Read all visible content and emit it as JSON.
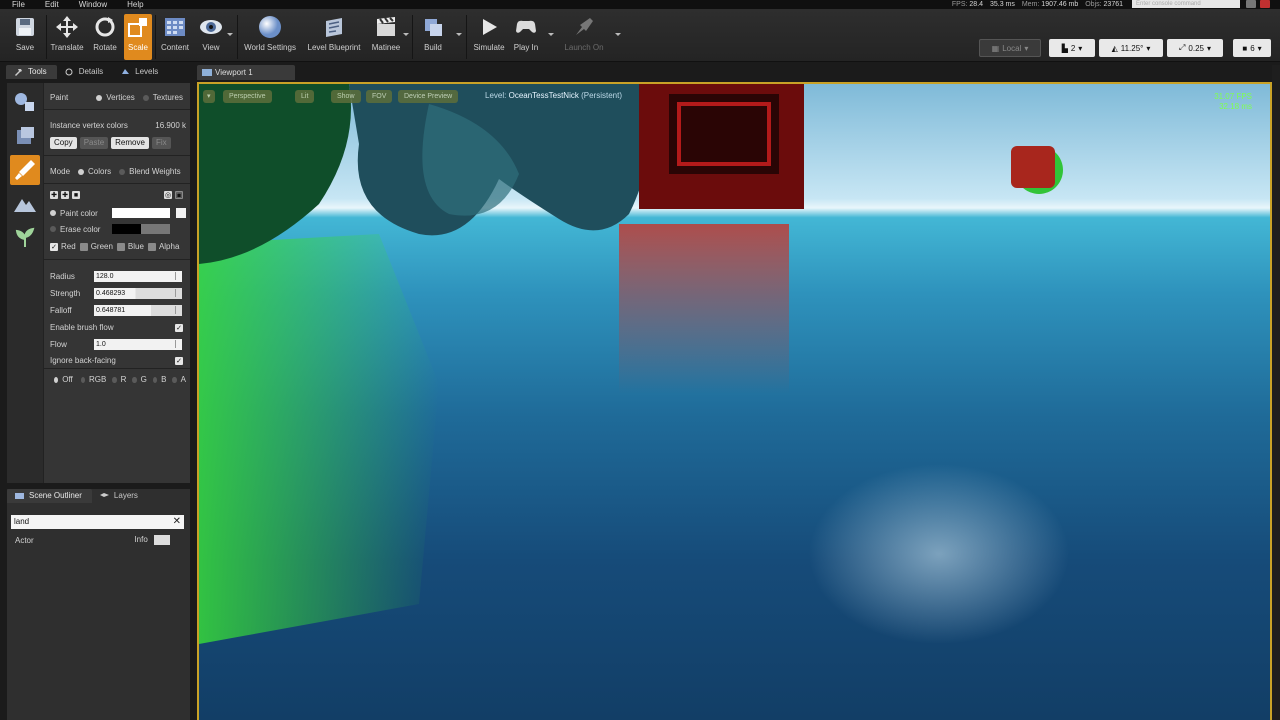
{
  "menu": [
    "File",
    "Edit",
    "Window",
    "Help"
  ],
  "stats": {
    "fps_label": "FPS:",
    "fps_value": "28.4",
    "ms_value": "35.3 ms",
    "mem_label": "Mem:",
    "mem_value": "1907.46 mb",
    "objs_label": "Objs:",
    "objs_value": "23761"
  },
  "console": {
    "placeholder": "Enter console command"
  },
  "toolbar": {
    "save": "Save",
    "translate": "Translate",
    "rotate": "Rotate",
    "scale": "Scale",
    "content": "Content",
    "view": "View",
    "world_settings": "World Settings",
    "level_blueprint": "Level Blueprint",
    "matinee": "Matinee",
    "build": "Build",
    "simulate": "Simulate",
    "play_in": "Play In",
    "launch_on": "Launch On"
  },
  "snapping": {
    "space": "Local",
    "grid": "2",
    "rotation": "11.25°",
    "scale": "0.25",
    "camera_speed": "6"
  },
  "tabs": {
    "tools": "Tools",
    "details": "Details",
    "levels": "Levels",
    "viewport": "Viewport 1",
    "scene_outliner": "Scene Outliner",
    "layers": "Layers"
  },
  "paint": {
    "paint_label": "Paint",
    "vertices": "Vertices",
    "textures": "Textures",
    "instance_label": "Instance vertex colors",
    "instance_size": "16.900 k",
    "copy": "Copy",
    "paste": "Paste",
    "remove": "Remove",
    "fix": "Fix",
    "mode_label": "Mode",
    "mode_colors": "Colors",
    "mode_blend": "Blend Weights",
    "paint_color": "Paint color",
    "erase_color": "Erase color",
    "channel_red": "Red",
    "channel_green": "Green",
    "channel_blue": "Blue",
    "channel_alpha": "Alpha",
    "radius_label": "Radius",
    "radius_value": "128.0",
    "strength_label": "Strength",
    "strength_value": "0.468293",
    "falloff_label": "Falloff",
    "falloff_value": "0.648781",
    "flow_enable_label": "Enable brush flow",
    "flow_label": "Flow",
    "flow_value": "1.0",
    "backface_label": "Ignore back-facing",
    "view_off": "Off",
    "view_rgb": "RGB",
    "view_r": "R",
    "view_g": "G",
    "view_b": "B",
    "view_a": "A"
  },
  "outliner": {
    "search_value": "land",
    "col_actor": "Actor",
    "col_info": "Info"
  },
  "viewport": {
    "perspective": "Perspective",
    "lit": "Lit",
    "show": "Show",
    "fov": "FOV",
    "device_preview": "Device Preview",
    "level_label": "Level:",
    "level_name": "OceanTessTestNick",
    "level_suffix": "(Persistent)",
    "fps": "31.07 FPS",
    "ms": "32.18 ms"
  },
  "colors": {
    "accent": "#e08a1e",
    "viewport_border": "#c9a227",
    "fps_text": "#7fff50"
  }
}
